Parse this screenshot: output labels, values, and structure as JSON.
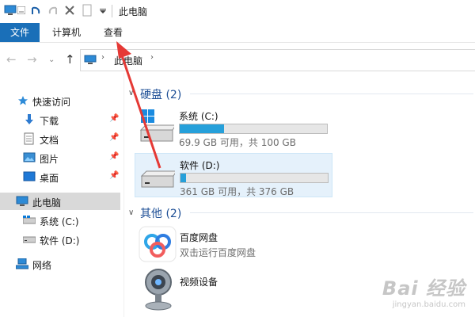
{
  "window": {
    "title": "此电脑"
  },
  "ribbon": {
    "tabs": [
      {
        "label": "文件"
      },
      {
        "label": "计算机"
      },
      {
        "label": "查看"
      }
    ]
  },
  "address": {
    "crumbs": [
      {
        "label": "此电脑"
      }
    ]
  },
  "sidebar": {
    "items": [
      {
        "label": "快速访问",
        "icon": "star-icon"
      },
      {
        "label": "下载",
        "icon": "download-icon",
        "pinned": true
      },
      {
        "label": "文档",
        "icon": "document-icon",
        "pinned": true
      },
      {
        "label": "图片",
        "icon": "picture-icon",
        "pinned": true
      },
      {
        "label": "桌面",
        "icon": "desktop-icon",
        "pinned": true
      },
      {
        "label": "此电脑",
        "icon": "computer-icon",
        "selected": true
      },
      {
        "label": "系统 (C:)",
        "icon": "drive-icon"
      },
      {
        "label": "软件 (D:)",
        "icon": "drive-icon"
      },
      {
        "label": "网络",
        "icon": "network-icon"
      }
    ]
  },
  "groups": {
    "disks": {
      "title": "硬盘 (2)"
    },
    "other": {
      "title": "其他 (2)"
    }
  },
  "drives": [
    {
      "name": "系统 (C:)",
      "info": "69.9 GB 可用，共 100 GB",
      "used_fraction": 0.301
    },
    {
      "name": "软件 (D:)",
      "info": "361 GB 可用，共 376 GB",
      "used_fraction": 0.04,
      "selected": true
    }
  ],
  "other_items": [
    {
      "name": "百度网盘",
      "sub": "双击运行百度网盘",
      "icon": "baidu-netdisk-icon"
    },
    {
      "name": "视频设备",
      "icon": "webcam-icon"
    }
  ],
  "watermark": {
    "line1": "Bai 经验",
    "line2": "jingyan.baidu.com"
  },
  "colors": {
    "accent": "#1a6fb8",
    "bar_fill": "#26a0da",
    "group_head": "#1e4f96",
    "arrow": "#e53935"
  }
}
